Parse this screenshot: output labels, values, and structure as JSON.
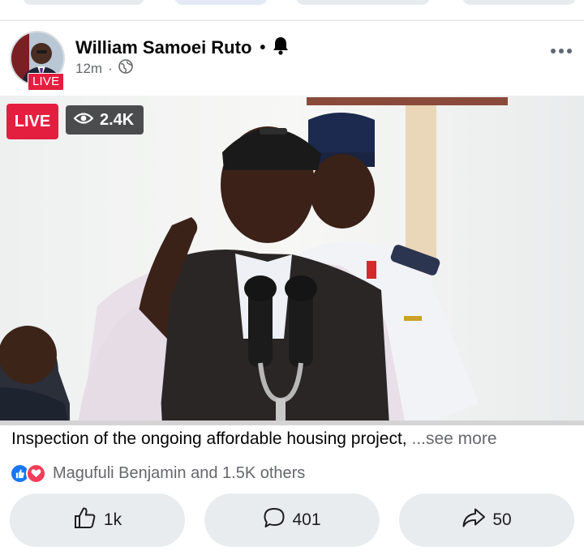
{
  "post": {
    "author": "William Samoei Ruto",
    "author_dot": "•",
    "avatar_live_label": "LIVE",
    "time": "12m",
    "time_sep": "·",
    "audience_icon": "globe-icon",
    "follow_icon": "bell-icon",
    "more_icon": "more-dots-icon"
  },
  "video": {
    "live_label": "LIVE",
    "views": "2.4K",
    "views_icon": "eye-icon"
  },
  "caption": {
    "text": "Inspection of the ongoing affordable housing project, ",
    "see_more": "...see more"
  },
  "reactions": {
    "summary": "Magufuli Benjamin and 1.5K others",
    "icons": [
      "like-reaction-icon",
      "love-reaction-icon"
    ]
  },
  "actions": {
    "like": {
      "icon": "thumbs-up-icon",
      "count": "1k"
    },
    "comment": {
      "icon": "comment-icon",
      "count": "401"
    },
    "share": {
      "icon": "share-icon",
      "count": "50"
    }
  },
  "colors": {
    "live_red": "#e41e3f",
    "view_badge": "#4b4c4d",
    "secondary_text": "#65676b",
    "action_bg": "#e9ecef",
    "like_blue": "#1877f2",
    "love_red": "#f33e58"
  }
}
